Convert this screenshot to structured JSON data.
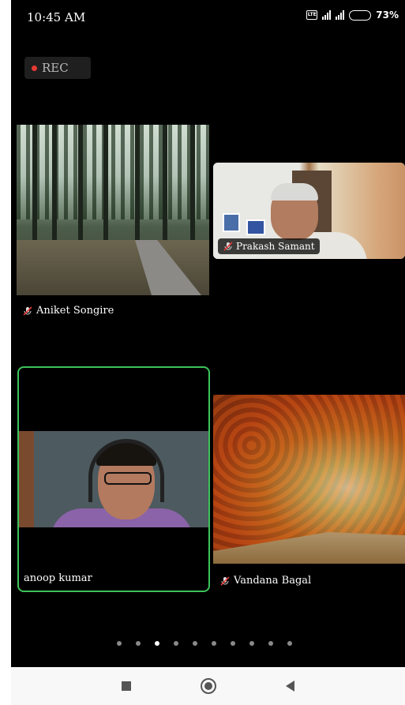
{
  "status_bar": {
    "time": "10:45 AM",
    "vo_badge": "Vo LTE",
    "battery": "73%",
    "battery_fraction": 0.73,
    "battery_color": "#f5b400"
  },
  "recording": {
    "label": "REC",
    "dot_color": "#e53935"
  },
  "participants": [
    {
      "name": "Aniket Songire",
      "muted": true,
      "icon": "mic-muted-icon"
    },
    {
      "name": "Prakash Samant",
      "muted": true,
      "icon": "mic-muted-icon"
    },
    {
      "name": "anoop kumar",
      "muted": false,
      "active_speaker": true,
      "highlight_color": "#3cc45a"
    },
    {
      "name": "Vandana Bagal",
      "muted": true,
      "icon": "mic-muted-icon"
    }
  ],
  "pager": {
    "total": 10,
    "current": 3
  },
  "nav": {
    "icons": [
      "recents-square-icon",
      "home-circle-icon",
      "back-triangle-icon"
    ]
  }
}
